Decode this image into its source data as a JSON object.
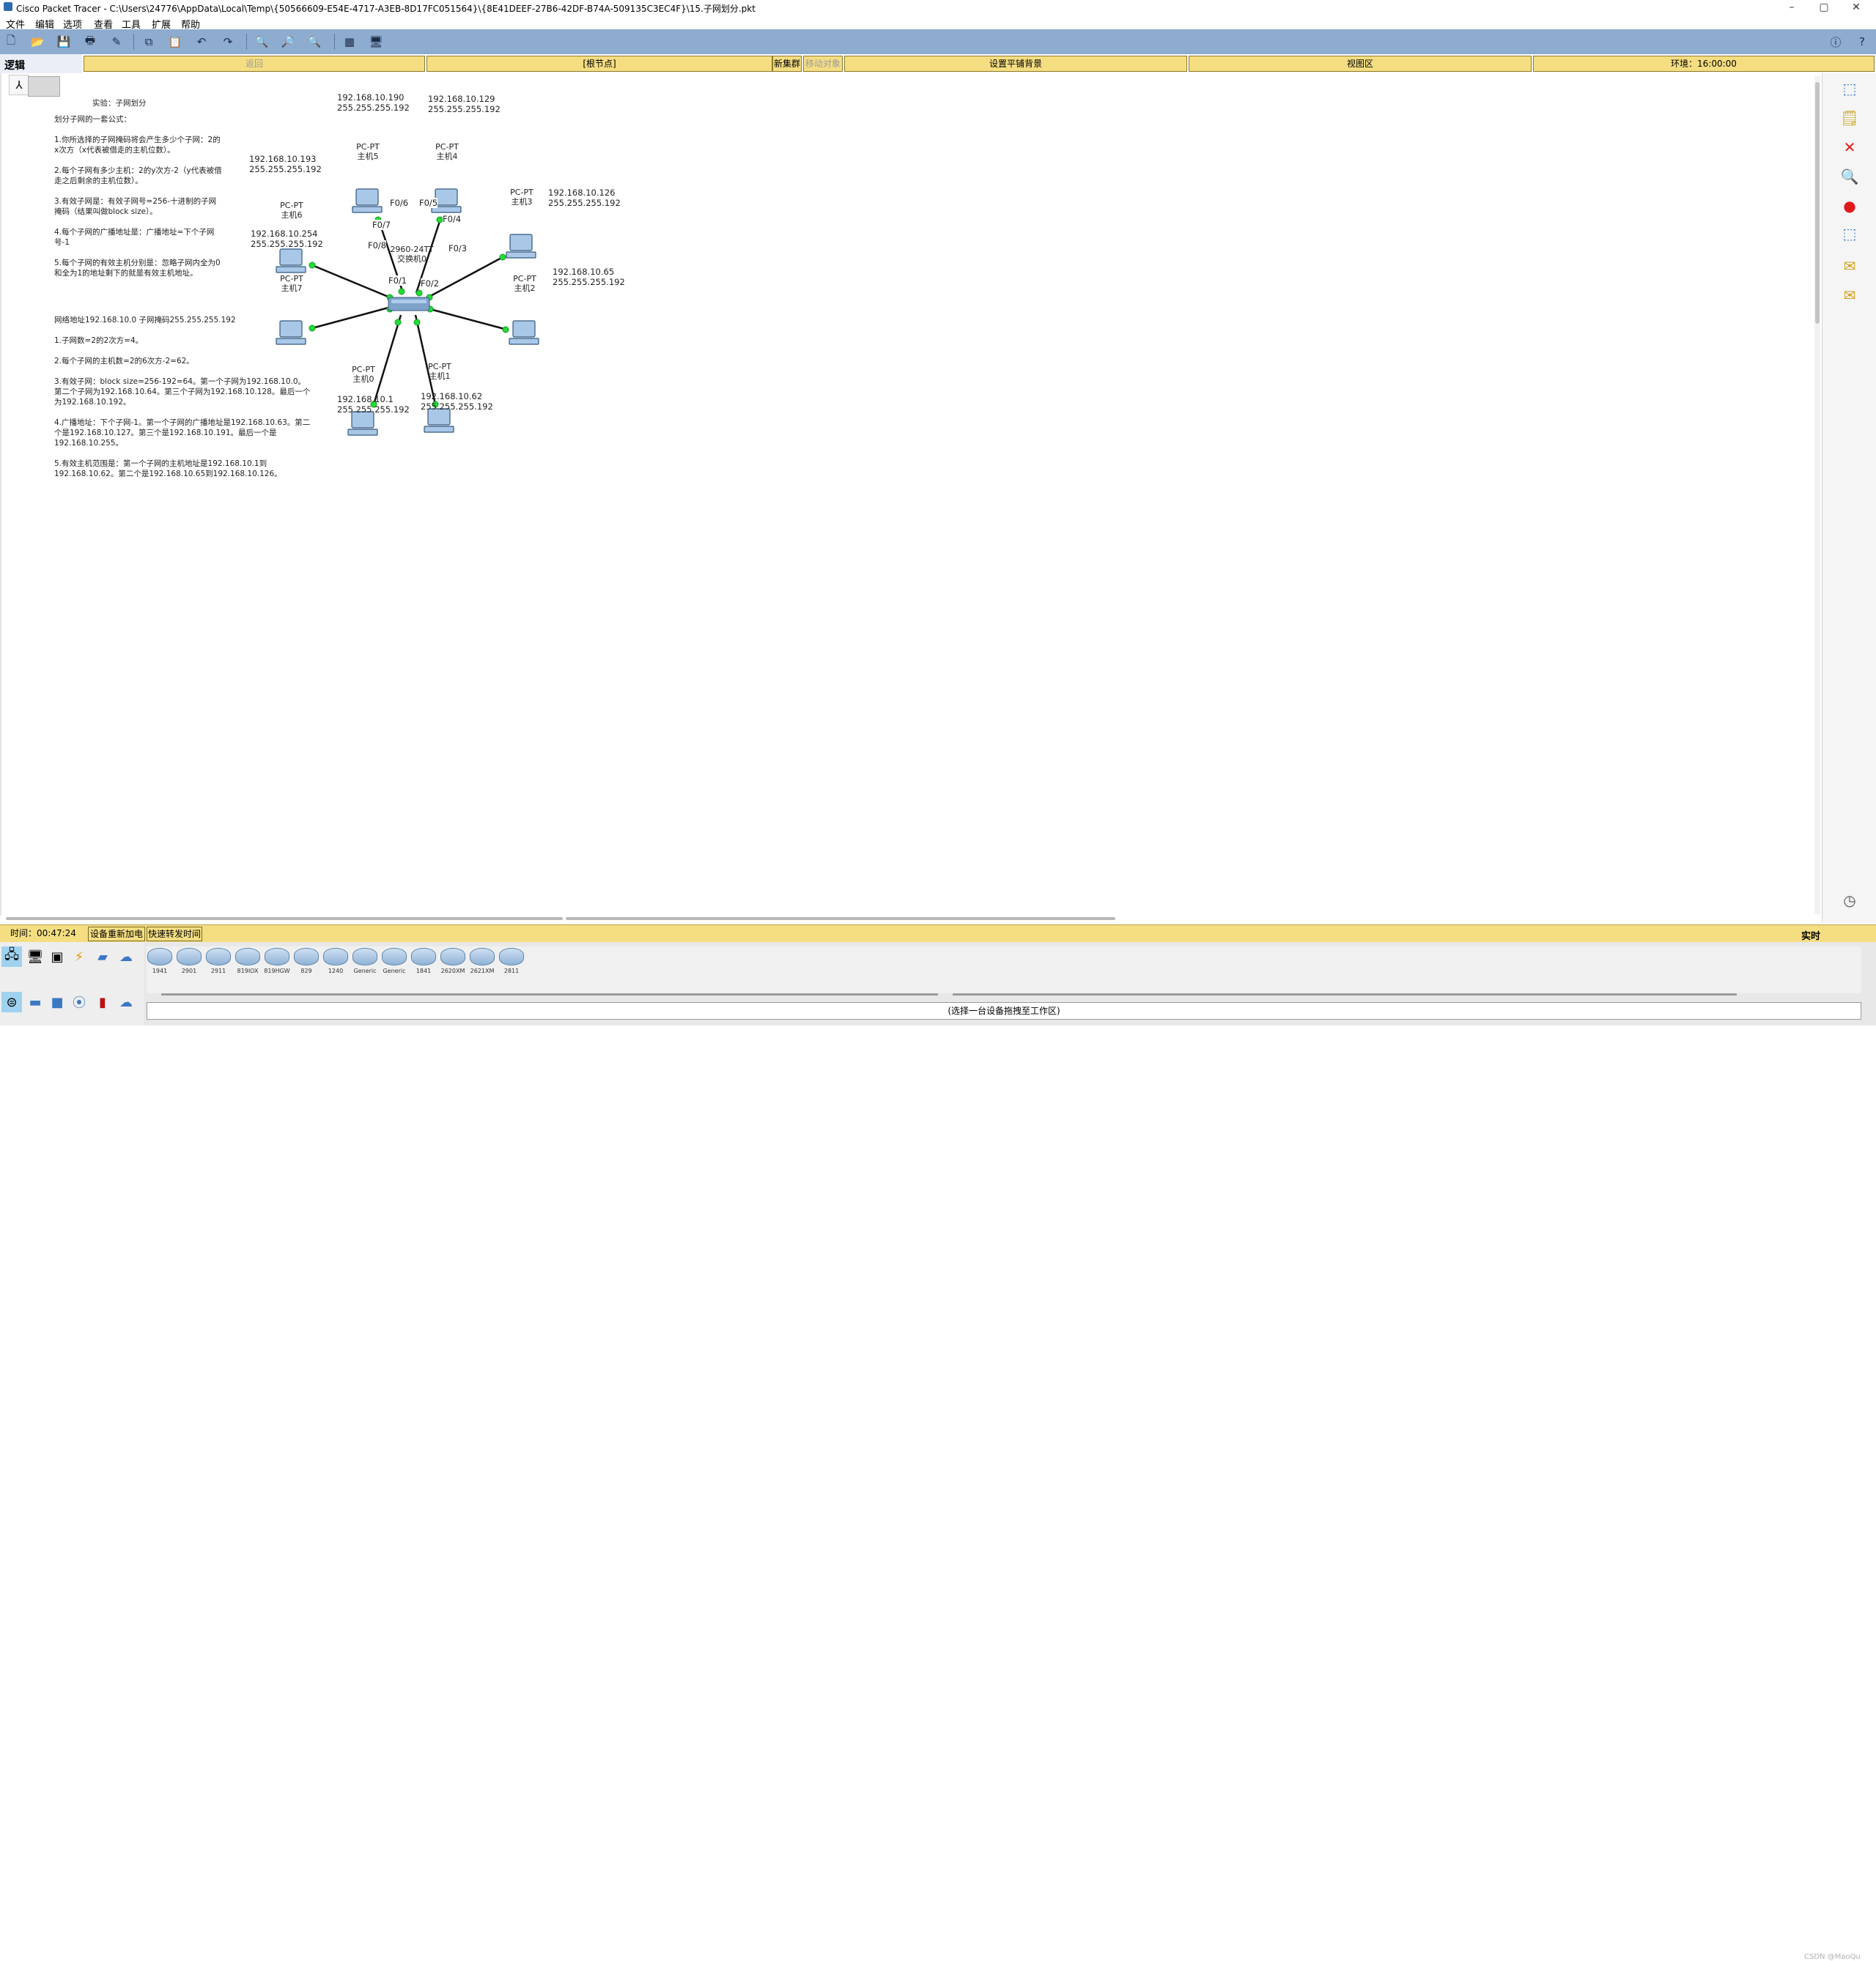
{
  "window": {
    "title": "Cisco Packet Tracer - C:\\Users\\24776\\AppData\\Local\\Temp\\{50566609-E54E-4717-A3EB-8D17FC051564}\\{8E41DEEF-27B6-42DF-B74A-509135C3EC4F}\\15.子网划分.pkt",
    "controls": [
      "–",
      "▢",
      "✕"
    ]
  },
  "menu": [
    "文件",
    "编辑",
    "选项",
    "查看",
    "工具",
    "扩展",
    "帮助"
  ],
  "nav": {
    "logic_label": "逻辑",
    "back": "返回",
    "root": "[根节点]",
    "new_cluster": "新集群",
    "move_object": "移动对象",
    "set_background": "设置平铺背景",
    "viewport": "视图区",
    "environment": "环境：16:00:00"
  },
  "notes": {
    "title": "实验：子网划分",
    "formula": "划分子网的一套公式：\n\n1.你所选择的子网掩码将会产生多少个子网：2的x次方（x代表被借走的主机位数）。\n\n2.每个子网有多少主机：2的y次方-2（y代表被借走之后剩余的主机位数）。\n\n3.有效子网是：有效子网号=256-十进制的子网掩码（结果叫做block size）。\n\n4.每个子网的广播地址是：广播地址=下个子网号-1\n\n5.每个子网的有效主机分别是：忽略子网内全为0和全为1的地址剩下的就是有效主机地址。",
    "example": "网络地址192.168.10.0 子网掩码255.255.255.192\n\n1.子网数=2的2次方=4。\n\n2.每个子网的主机数=2的6次方-2=62。\n\n3.有效子网：block size=256-192=64。第一个子网为192.168.10.0。第二个子网为192.168.10.64。第三个子网为192.168.10.128。最后一个为192.168.10.192。\n\n4.广播地址：下个子网-1。第一个子网的广播地址是192.168.10.63。第二个是192.168.10.127。第三个是192.168.10.191。最后一个是192.168.10.255。\n\n5.有效主机范围是：第一个子网的主机地址是192.168.10.1到192.168.10.62。第二个是192.168.10.65到192.168.10.126。"
  },
  "topology": {
    "switch": {
      "type": "2960-24TT",
      "name": "交换机0"
    },
    "hosts": [
      {
        "type": "PC-PT",
        "name": "主机0",
        "ip": "192.168.10.1",
        "mask": "255.255.255.192",
        "port": "F0/1"
      },
      {
        "type": "PC-PT",
        "name": "主机1",
        "ip": "192.168.10.62",
        "mask": "255.255.255.192",
        "port": "F0/2"
      },
      {
        "type": "PC-PT",
        "name": "主机2",
        "ip": "192.168.10.65",
        "mask": "255.255.255.192",
        "port": "F0/3"
      },
      {
        "type": "PC-PT",
        "name": "主机3",
        "ip": "192.168.10.126",
        "mask": "255.255.255.192",
        "port": "F0/4"
      },
      {
        "type": "PC-PT",
        "name": "主机4",
        "ip": "192.168.10.129",
        "mask": "255.255.255.192",
        "port": "F0/5"
      },
      {
        "type": "PC-PT",
        "name": "主机5",
        "ip": "192.168.10.190",
        "mask": "255.255.255.192",
        "port": "F0/6"
      },
      {
        "type": "PC-PT",
        "name": "主机6",
        "ip": "192.168.10.193",
        "mask": "255.255.255.192",
        "port": "F0/7"
      },
      {
        "type": "PC-PT",
        "name": "主机7",
        "ip": "192.168.10.254",
        "mask": "255.255.255.192",
        "port": "F0/8"
      }
    ]
  },
  "status": {
    "time_label": "时间：00:47:24",
    "power_cycle": "设备重新加电",
    "fast_forward": "快速转发时间",
    "realtime": "实时"
  },
  "devices": [
    "1941",
    "2901",
    "2911",
    "819IOX",
    "819HGW",
    "829",
    "1240",
    "Generic",
    "Generic",
    "1841",
    "2620XM",
    "2621XM",
    "2811"
  ],
  "device_hint": "(选择一台设备拖拽至工作区)",
  "watermark": "CSDN @MaoQu"
}
